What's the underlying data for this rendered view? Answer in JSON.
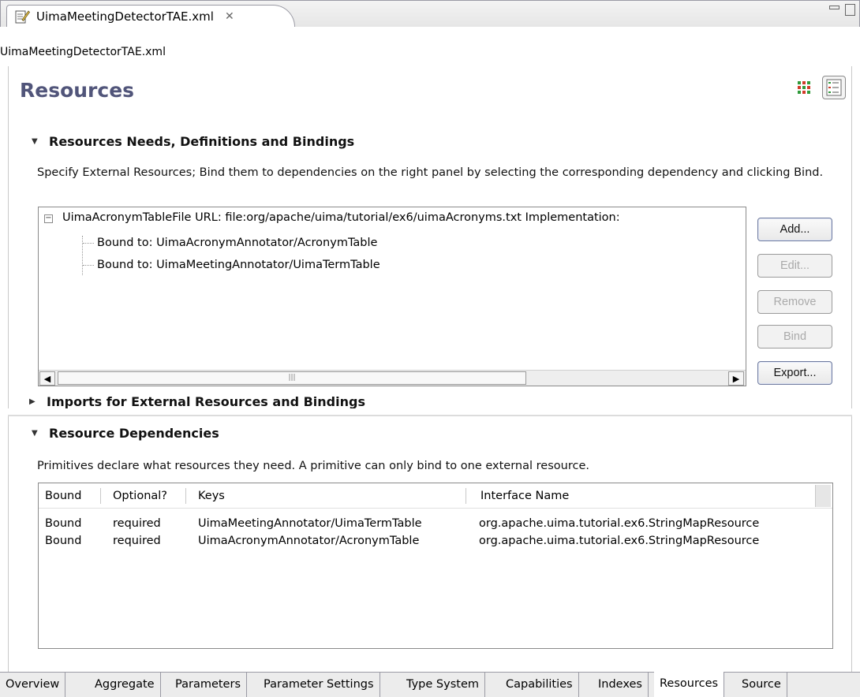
{
  "editor_tab": {
    "title": "UimaMeetingDetectorTAE.xml",
    "close_glyph": "✕"
  },
  "subtitle": "UimaMeetingDetectorTAE.xml",
  "page_title": "Resources",
  "resources_section": {
    "title": "Resources Needs, Definitions and Bindings",
    "description": "Specify External Resources; Bind them to dependencies on the right panel by selecting the corresponding dependency and clicking Bind.",
    "tree": {
      "root": "UimaAcronymTableFile  URL: file:org/apache/uima/tutorial/ex6/uimaAcronyms.txt  Implementation:",
      "children": [
        "Bound to: UimaAcronymAnnotator/AcronymTable",
        "Bound to: UimaMeetingAnnotator/UimaTermTable"
      ]
    },
    "buttons": {
      "add": "Add...",
      "edit": "Edit...",
      "remove": "Remove",
      "bind": "Bind",
      "export": "Export..."
    }
  },
  "imports_section": {
    "title": "Imports for External Resources and Bindings"
  },
  "dependencies_section": {
    "title": "Resource Dependencies",
    "description": "Primitives declare what resources they need. A primitive can only bind to one external resource.",
    "columns": [
      "Bound",
      "Optional?",
      "Keys",
      "Interface Name"
    ],
    "rows": [
      [
        "Bound",
        "required",
        "UimaMeetingAnnotator/UimaTermTable",
        "org.apache.uima.tutorial.ex6.StringMapResource"
      ],
      [
        "Bound",
        "required",
        "UimaAcronymAnnotator/AcronymTable",
        "org.apache.uima.tutorial.ex6.StringMapResource"
      ]
    ]
  },
  "page_tabs": [
    "Overview",
    "Aggregate",
    "Parameters",
    "Parameter Settings",
    "Type System",
    "Capabilities",
    "Indexes",
    "Resources",
    "Source"
  ],
  "active_page_tab": "Resources",
  "colors": {
    "title": "#51557a",
    "border": "#8a8a8a",
    "tab_bg": "#ececec"
  }
}
